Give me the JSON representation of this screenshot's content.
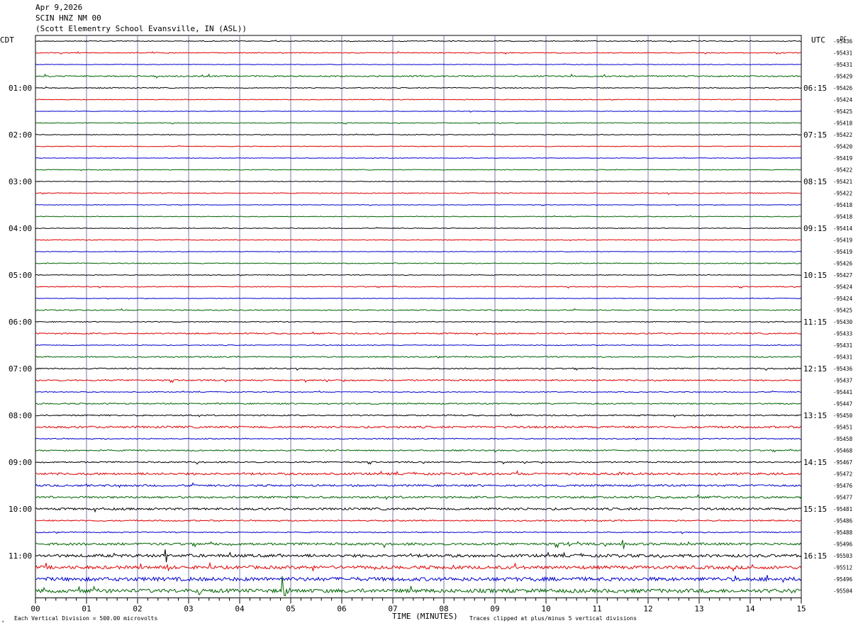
{
  "header": {
    "date": "Apr 9,2026",
    "station": "SCIN HNZ NM 00",
    "location": "(Scott Elementry School Evansville, IN (ASL))"
  },
  "left_timezone": "CDT",
  "right_timezone": "UTC",
  "dc_label": "DC",
  "footer": {
    "scale_note": "Each Vertical Division =  500.00 microvolts",
    "axis_title": "TIME (MINUTES)",
    "clip_note": "Traces clipped at plus/minus 5 vertical divisions"
  },
  "colors": {
    "cycle": [
      "#000000",
      "#e00000",
      "#0000cc",
      "#006400"
    ],
    "grid": "#7777aa"
  },
  "chart_data": {
    "type": "line",
    "title": "SCIN HNZ NM 00",
    "xlabel": "TIME (MINUTES)",
    "xlim": [
      0,
      15
    ],
    "x_ticks": [
      "00",
      "01",
      "02",
      "03",
      "04",
      "05",
      "06",
      "07",
      "08",
      "09",
      "10",
      "11",
      "12",
      "13",
      "14",
      "15"
    ],
    "left_hour_labels": [
      "01:00",
      "02:00",
      "03:00",
      "04:00",
      "05:00",
      "06:00",
      "07:00",
      "08:00",
      "09:00",
      "10:00",
      "11:00"
    ],
    "right_hour_labels": [
      "06:15",
      "07:15",
      "08:15",
      "09:15",
      "10:15",
      "11:15",
      "12:15",
      "13:15",
      "14:15",
      "15:15",
      "16:15"
    ],
    "dc_offsets": [
      "-95436",
      "-95431",
      "-95431",
      "-95429",
      "-95426",
      "-95424",
      "-95425",
      "-95418",
      "-95422",
      "-95420",
      "-95419",
      "-95422",
      "-95421",
      "-95422",
      "-95418",
      "-95418",
      "-95414",
      "-95419",
      "-95419",
      "-95426",
      "-95427",
      "-95424",
      "-95424",
      "-95425",
      "-95430",
      "-95433",
      "-95431",
      "-95431",
      "-95436",
      "-95437",
      "-95441",
      "-95447",
      "-95450",
      "-95451",
      "-95458",
      "-95468",
      "-95467",
      "-95472",
      "-95476",
      "-95477",
      "-95481",
      "-95486",
      "-95488",
      "-95496",
      "-95503",
      "-95512",
      "-95496",
      "-95504"
    ],
    "trace_noise_level": [
      0.6,
      0.6,
      0.4,
      0.9,
      0.6,
      0.5,
      0.4,
      0.5,
      0.5,
      0.5,
      0.4,
      0.5,
      0.5,
      0.6,
      0.4,
      0.5,
      0.5,
      0.6,
      0.4,
      0.6,
      0.5,
      0.6,
      0.4,
      0.7,
      0.6,
      0.9,
      0.6,
      0.8,
      0.8,
      1.0,
      0.6,
      0.9,
      0.9,
      1.4,
      0.7,
      0.9,
      0.9,
      1.5,
      1.3,
      1.4,
      1.5,
      0.9,
      0.7,
      1.6,
      2.0,
      2.2,
      2.6,
      2.6
    ],
    "events": [
      {
        "trace": 37,
        "minute": 11.45,
        "amplitude": 2.5
      },
      {
        "trace": 38,
        "minute": 0.95,
        "amplitude": 3
      },
      {
        "trace": 43,
        "minute": 11.5,
        "amplitude": 14
      },
      {
        "trace": 43,
        "minute": 10.45,
        "amplitude": 3
      },
      {
        "trace": 44,
        "minute": 2.55,
        "amplitude": 14
      },
      {
        "trace": 44,
        "minute": 4.75,
        "amplitude": 4
      },
      {
        "trace": 44,
        "minute": 12.25,
        "amplitude": 3
      },
      {
        "trace": 45,
        "minute": 2.6,
        "amplitude": 4
      },
      {
        "trace": 45,
        "minute": 6.65,
        "amplitude": 4
      },
      {
        "trace": 45,
        "minute": 8.15,
        "amplitude": 4
      },
      {
        "trace": 46,
        "minute": 12.7,
        "amplitude": 7
      },
      {
        "trace": 47,
        "minute": 0.15,
        "amplitude": 5
      },
      {
        "trace": 47,
        "minute": 1.15,
        "amplitude": 9
      },
      {
        "trace": 47,
        "minute": 3.2,
        "amplitude": 6
      },
      {
        "trace": 47,
        "minute": 4.85,
        "amplitude": 30
      }
    ]
  }
}
